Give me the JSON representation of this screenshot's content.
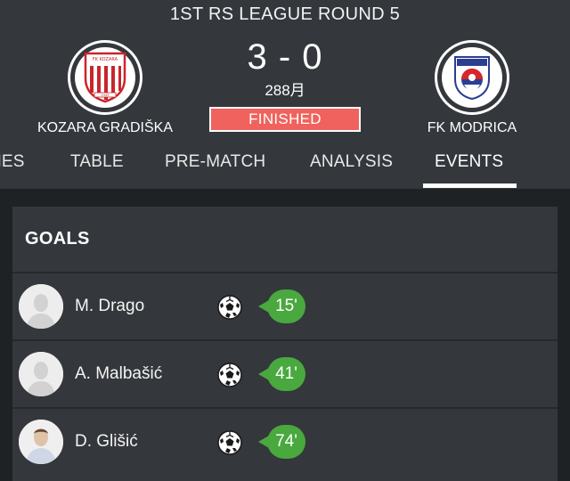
{
  "header": {
    "round_title": "1ST RS LEAGUE ROUND 5",
    "score": "3 - 0",
    "date": "288月",
    "status": "FINISHED",
    "home_team": {
      "name": "KOZARA GRADIŠKA",
      "logo": "kozara-gradiska-logo"
    },
    "away_team": {
      "name": "FK MODRICA",
      "logo": "fk-modrica-logo"
    }
  },
  "tabs": [
    {
      "label": "HES"
    },
    {
      "label": "TABLE"
    },
    {
      "label": "PRE-MATCH"
    },
    {
      "label": "ANALYSIS"
    },
    {
      "label": "EVENTS",
      "active": true
    }
  ],
  "goals": {
    "title": "GOALS",
    "items": [
      {
        "player": "M. Drago",
        "minute": "15'",
        "icon": "soccer-ball-icon"
      },
      {
        "player": "A. Malbašić",
        "minute": "41'",
        "icon": "soccer-ball-icon"
      },
      {
        "player": "D. Glišić",
        "minute": "74'",
        "icon": "soccer-ball-icon"
      }
    ]
  },
  "colors": {
    "background": "#1f2225",
    "panel": "#34373b",
    "status_badge": "#f0625d",
    "minute_badge": "#49a83e"
  }
}
